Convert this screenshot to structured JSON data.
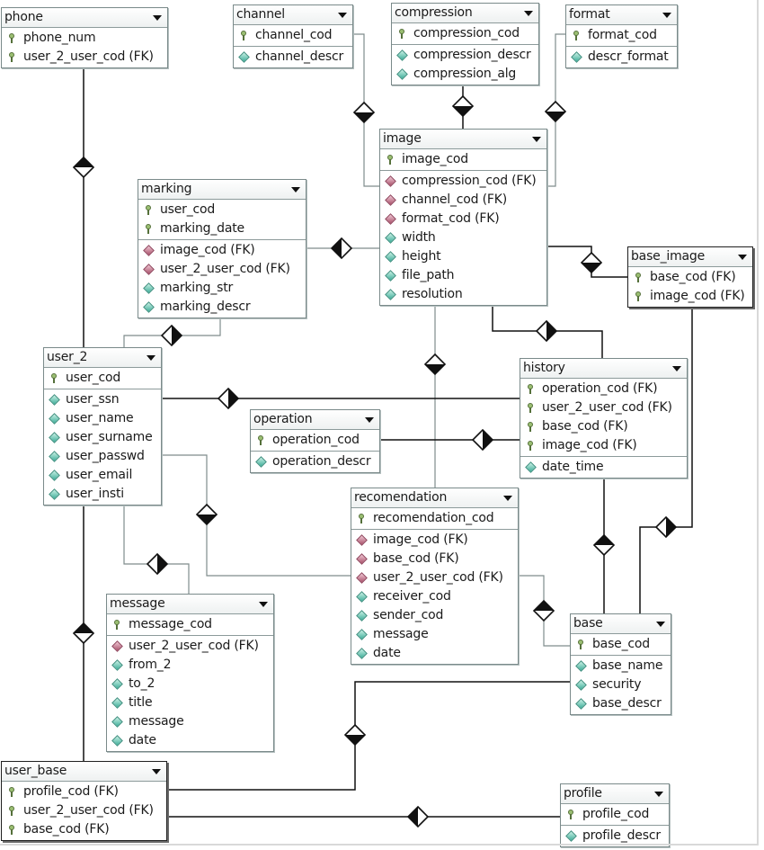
{
  "diagram": {
    "entities": {
      "phone": {
        "title": "phone",
        "keys": [
          {
            "name": "phone_num",
            "kind": "key"
          },
          {
            "name": "user_2_user_cod (FK)",
            "kind": "key"
          }
        ],
        "attrs": []
      },
      "channel": {
        "title": "channel",
        "keys": [
          {
            "name": "channel_cod",
            "kind": "key"
          }
        ],
        "attrs": [
          {
            "name": "channel_descr",
            "kind": "attr"
          }
        ]
      },
      "compression": {
        "title": "compression",
        "keys": [
          {
            "name": "compression_cod",
            "kind": "key"
          }
        ],
        "attrs": [
          {
            "name": "compression_descr",
            "kind": "attr"
          },
          {
            "name": "compression_alg",
            "kind": "attr"
          }
        ]
      },
      "format": {
        "title": "format",
        "keys": [
          {
            "name": "format_cod",
            "kind": "key"
          }
        ],
        "attrs": [
          {
            "name": "descr_format",
            "kind": "attr"
          }
        ]
      },
      "image": {
        "title": "image",
        "keys": [
          {
            "name": "image_cod",
            "kind": "key"
          }
        ],
        "attrs": [
          {
            "name": "compression_cod (FK)",
            "kind": "fk"
          },
          {
            "name": "channel_cod (FK)",
            "kind": "fk"
          },
          {
            "name": "format_cod (FK)",
            "kind": "fk"
          },
          {
            "name": "width",
            "kind": "attr"
          },
          {
            "name": "height",
            "kind": "attr"
          },
          {
            "name": "file_path",
            "kind": "attr"
          },
          {
            "name": "resolution",
            "kind": "attr"
          }
        ]
      },
      "marking": {
        "title": "marking",
        "keys": [
          {
            "name": "user_cod",
            "kind": "key"
          },
          {
            "name": "marking_date",
            "kind": "key"
          }
        ],
        "attrs": [
          {
            "name": "image_cod (FK)",
            "kind": "fk"
          },
          {
            "name": "user_2_user_cod (FK)",
            "kind": "fk"
          },
          {
            "name": "marking_str",
            "kind": "attr"
          },
          {
            "name": "marking_descr",
            "kind": "attr"
          }
        ]
      },
      "base_image": {
        "title": "base_image",
        "keys": [
          {
            "name": "base_cod (FK)",
            "kind": "key"
          },
          {
            "name": "image_cod (FK)",
            "kind": "key"
          }
        ],
        "attrs": []
      },
      "user_2": {
        "title": "user_2",
        "keys": [
          {
            "name": "user_cod",
            "kind": "key"
          }
        ],
        "attrs": [
          {
            "name": "user_ssn",
            "kind": "attr"
          },
          {
            "name": "user_name",
            "kind": "attr"
          },
          {
            "name": "user_surname",
            "kind": "attr"
          },
          {
            "name": "user_passwd",
            "kind": "attr"
          },
          {
            "name": "user_email",
            "kind": "attr"
          },
          {
            "name": "user_insti",
            "kind": "attr"
          }
        ]
      },
      "history": {
        "title": "history",
        "keys": [
          {
            "name": "operation_cod (FK)",
            "kind": "key"
          },
          {
            "name": "user_2_user_cod (FK)",
            "kind": "key"
          },
          {
            "name": "base_cod (FK)",
            "kind": "key"
          },
          {
            "name": "image_cod (FK)",
            "kind": "key"
          }
        ],
        "attrs": [
          {
            "name": "date_time",
            "kind": "attr"
          }
        ]
      },
      "operation": {
        "title": "operation",
        "keys": [
          {
            "name": "operation_cod",
            "kind": "key"
          }
        ],
        "attrs": [
          {
            "name": "operation_descr",
            "kind": "attr"
          }
        ]
      },
      "recomendation": {
        "title": "recomendation",
        "keys": [
          {
            "name": "recomendation_cod",
            "kind": "key"
          }
        ],
        "attrs": [
          {
            "name": "image_cod (FK)",
            "kind": "fk"
          },
          {
            "name": "base_cod (FK)",
            "kind": "fk"
          },
          {
            "name": "user_2_user_cod (FK)",
            "kind": "fk"
          },
          {
            "name": "receiver_cod",
            "kind": "attr"
          },
          {
            "name": "sender_cod",
            "kind": "attr"
          },
          {
            "name": "message",
            "kind": "attr"
          },
          {
            "name": "date",
            "kind": "attr"
          }
        ]
      },
      "message": {
        "title": "message",
        "keys": [
          {
            "name": "message_cod",
            "kind": "key"
          }
        ],
        "attrs": [
          {
            "name": "user_2_user_cod (FK)",
            "kind": "fk"
          },
          {
            "name": "from_2",
            "kind": "attr"
          },
          {
            "name": "to_2",
            "kind": "attr"
          },
          {
            "name": "title",
            "kind": "attr"
          },
          {
            "name": "message",
            "kind": "attr"
          },
          {
            "name": "date",
            "kind": "attr"
          }
        ]
      },
      "base": {
        "title": "base",
        "keys": [
          {
            "name": "base_cod",
            "kind": "key"
          }
        ],
        "attrs": [
          {
            "name": "base_name",
            "kind": "attr"
          },
          {
            "name": "security",
            "kind": "attr"
          },
          {
            "name": "base_descr",
            "kind": "attr"
          }
        ]
      },
      "user_base": {
        "title": "user_base",
        "keys": [
          {
            "name": "profile_cod (FK)",
            "kind": "key"
          },
          {
            "name": "user_2_user_cod (FK)",
            "kind": "key"
          },
          {
            "name": "base_cod (FK)",
            "kind": "key"
          }
        ],
        "attrs": []
      },
      "profile": {
        "title": "profile",
        "keys": [
          {
            "name": "profile_cod",
            "kind": "key"
          }
        ],
        "attrs": [
          {
            "name": "profile_descr",
            "kind": "attr"
          }
        ]
      }
    },
    "relationships": [
      {
        "from": "phone",
        "to": "user_2"
      },
      {
        "from": "channel",
        "to": "image"
      },
      {
        "from": "compression",
        "to": "image"
      },
      {
        "from": "format",
        "to": "image"
      },
      {
        "from": "image",
        "to": "marking"
      },
      {
        "from": "marking",
        "to": "user_2"
      },
      {
        "from": "image",
        "to": "base_image"
      },
      {
        "from": "image",
        "to": "history"
      },
      {
        "from": "image",
        "to": "recomendation"
      },
      {
        "from": "user_2",
        "to": "history"
      },
      {
        "from": "operation",
        "to": "history"
      },
      {
        "from": "user_2",
        "to": "message"
      },
      {
        "from": "user_2",
        "to": "recomendation"
      },
      {
        "from": "history",
        "to": "base"
      },
      {
        "from": "base_image",
        "to": "base"
      },
      {
        "from": "recomendation",
        "to": "base"
      },
      {
        "from": "user_2",
        "to": "user_base"
      },
      {
        "from": "base",
        "to": "user_base"
      },
      {
        "from": "user_base",
        "to": "profile"
      }
    ]
  }
}
